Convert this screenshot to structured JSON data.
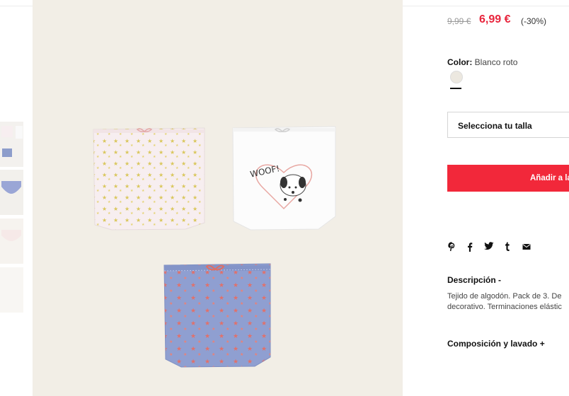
{
  "product": {
    "price_old": "9,99 €",
    "price_new": "6,99 €",
    "discount": "(-30%)",
    "color_label": "Color:",
    "color_value": "Blanco roto",
    "size_select": "Selecciona tu talla",
    "add_button": "Añadir a la",
    "share_icons": [
      "pinterest-icon",
      "facebook-icon",
      "twitter-icon",
      "tumblr-icon",
      "mail-icon"
    ],
    "description_title": "Descripción -",
    "description_text_1": "Tejido de algodón. Pack de 3. De",
    "description_text_2": "decorativo. Terminaciones elástic",
    "composition_title": "Composición y lavado +",
    "image_text": "WOOF!"
  },
  "colors": {
    "accent": "#f2283a",
    "price": "#e8243c"
  }
}
